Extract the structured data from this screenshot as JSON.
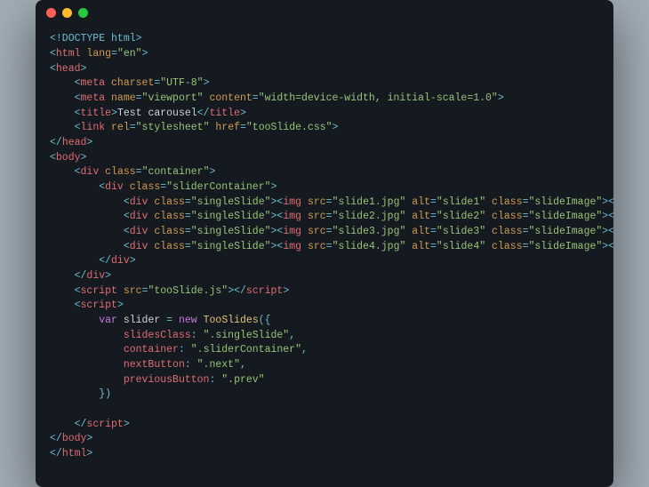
{
  "titlebar": {
    "dots": [
      "red",
      "yellow",
      "green"
    ]
  },
  "code": {
    "doctype": "<!DOCTYPE html>",
    "html_open_tag": "html",
    "html_open_attr": "lang",
    "html_open_val": "\"en\"",
    "head_tag": "head",
    "meta1_tag": "meta",
    "meta1_a1": "charset",
    "meta1_v1": "\"UTF-8\"",
    "meta2_tag": "meta",
    "meta2_a1": "name",
    "meta2_v1": "\"viewport\"",
    "meta2_a2": "content",
    "meta2_v2": "\"width=device-width, initial-scale=1.0\"",
    "title_tag": "title",
    "title_text": "Test carousel",
    "link_tag": "link",
    "link_a1": "rel",
    "link_v1": "\"stylesheet\"",
    "link_a2": "href",
    "link_v2": "\"tooSlide.css\"",
    "body_tag": "body",
    "div_tag": "div",
    "class_attr": "class",
    "container_val": "\"container\"",
    "sliderContainer_val": "\"sliderContainer\"",
    "singleSlide_val": "\"singleSlide\"",
    "img_tag": "img",
    "src_attr": "src",
    "alt_attr": "alt",
    "slideImages": [
      {
        "src": "\"slide1.jpg\"",
        "alt": "\"slide1\""
      },
      {
        "src": "\"slide2.jpg\"",
        "alt": "\"slide2\""
      },
      {
        "src": "\"slide3.jpg\"",
        "alt": "\"slide3\""
      },
      {
        "src": "\"slide4.jpg\"",
        "alt": "\"slide4\""
      }
    ],
    "slideImage_val": "\"slideImage\"",
    "script_tag": "script",
    "script_src_val": "\"tooSlide.js\"",
    "var_kw": "var",
    "slider_var": "slider",
    "new_kw": "new",
    "tooSlides_fn": "TooSlides",
    "opt1_k": "slidesClass",
    "opt1_v": "\".singleSlide\"",
    "opt2_k": "container",
    "opt2_v": "\".sliderContainer\"",
    "opt3_k": "nextButton",
    "opt3_v": "\".next\"",
    "opt4_k": "previousButton",
    "opt4_v": "\".prev\""
  }
}
